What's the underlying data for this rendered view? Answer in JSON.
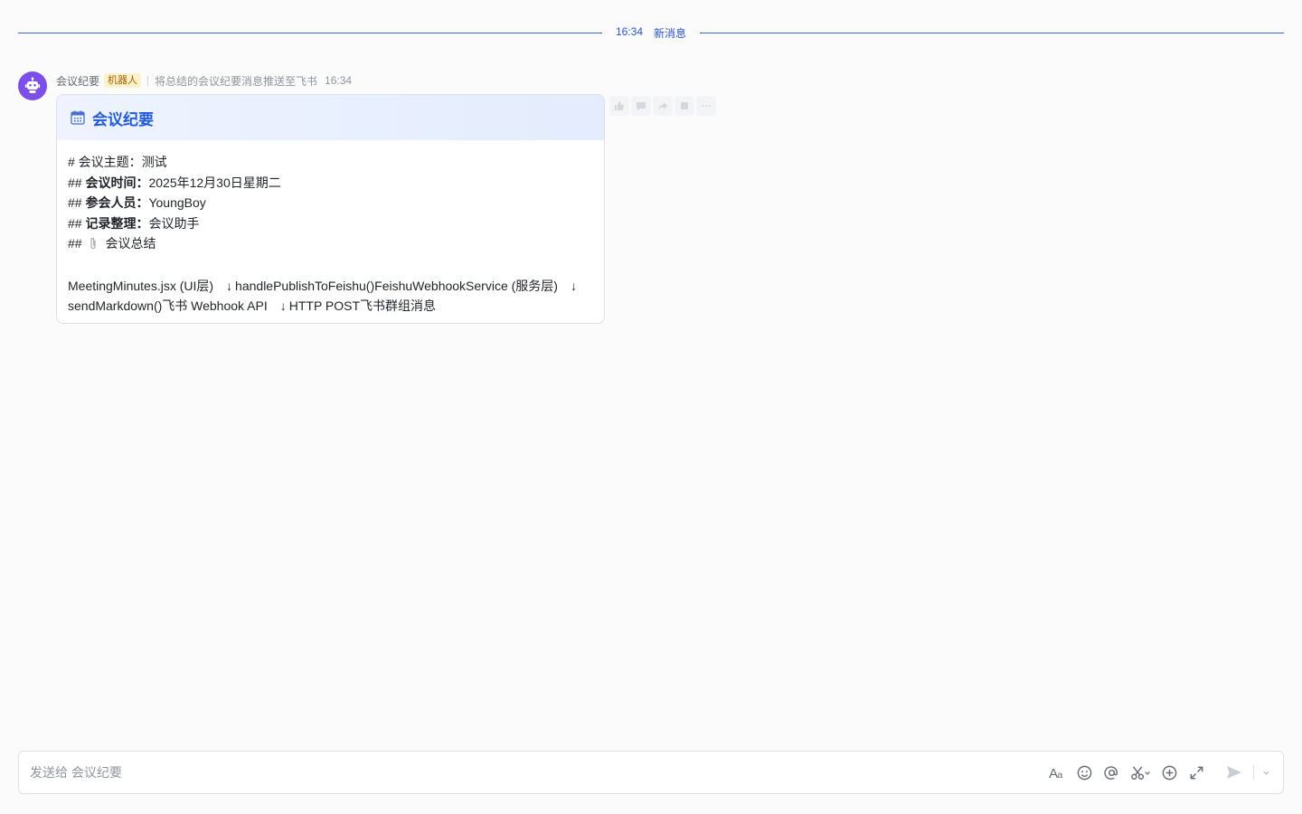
{
  "divider": {
    "time": "16:34",
    "label": "新消息"
  },
  "message": {
    "sender": "会议纪要",
    "bot_tag": "机器人",
    "description": "将总结的会议纪要消息推送至飞书",
    "time": "16:34",
    "avatar_icon": "robot-icon",
    "card": {
      "title": "会议纪要",
      "title_icon": "calendar-icon",
      "lines": {
        "l1_prefix": "# 会议主题：",
        "l1_value": "测试",
        "l2_prefix": "## ",
        "l2_key": "会议时间：",
        "l2_value": "2025年12月30日星期二",
        "l3_prefix": "## ",
        "l3_key": "参会人员：",
        "l3_value": "YoungBoy",
        "l4_prefix": "## ",
        "l4_key": "记录整理：",
        "l4_value": "会议助手",
        "l5_prefix": "## ",
        "l5_icon": "paperclip-icon",
        "l5_value": "会议总结"
      },
      "flow": {
        "step1": "MeetingMinutes.jsx (UI层)",
        "step2": "handlePublishToFeishu()FeishuWebhookService (服务层)",
        "step3": "sendMarkdown()飞书 Webhook API",
        "step4": "HTTP POST飞书群组消息",
        "arrow": "↓"
      }
    }
  },
  "actions": [
    "thumbs-up-icon",
    "comment-icon",
    "forward-icon",
    "bookmark-icon",
    "more-icon"
  ],
  "composer": {
    "placeholder": "发送给 会议纪要",
    "tools": [
      "font-format-icon",
      "emoji-icon",
      "mention-icon",
      "screenshot-icon",
      "add-icon",
      "expand-icon"
    ],
    "send_icon": "send-icon"
  }
}
